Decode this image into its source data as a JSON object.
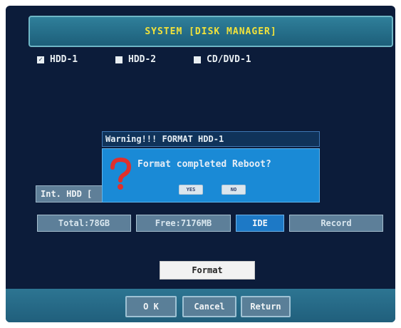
{
  "header": {
    "title": "SYSTEM [DISK MANAGER]"
  },
  "drives": [
    {
      "label": "HDD-1",
      "checked": true
    },
    {
      "label": "HDD-2",
      "checked": false
    },
    {
      "label": "CD/DVD-1",
      "checked": false
    }
  ],
  "disk_info": {
    "int_label": "Int. HDD [",
    "total": "Total:78GB",
    "free": "Free:7176MB",
    "interface": "IDE",
    "mode": "Record"
  },
  "format_button": "Format",
  "dialog": {
    "title": "Warning!!! FORMAT HDD-1",
    "message": "Format completed Reboot?",
    "yes_label": "YES",
    "no_label": "NO",
    "icon": "question-mark-icon"
  },
  "footer": {
    "ok_label": "O K",
    "cancel_label": "Cancel",
    "return_label": "Return"
  },
  "colors": {
    "background": "#0c1c3a",
    "title_text": "#f2e23a",
    "dialog_accent": "#1a8ad6",
    "question_mark": "#e0302c"
  }
}
